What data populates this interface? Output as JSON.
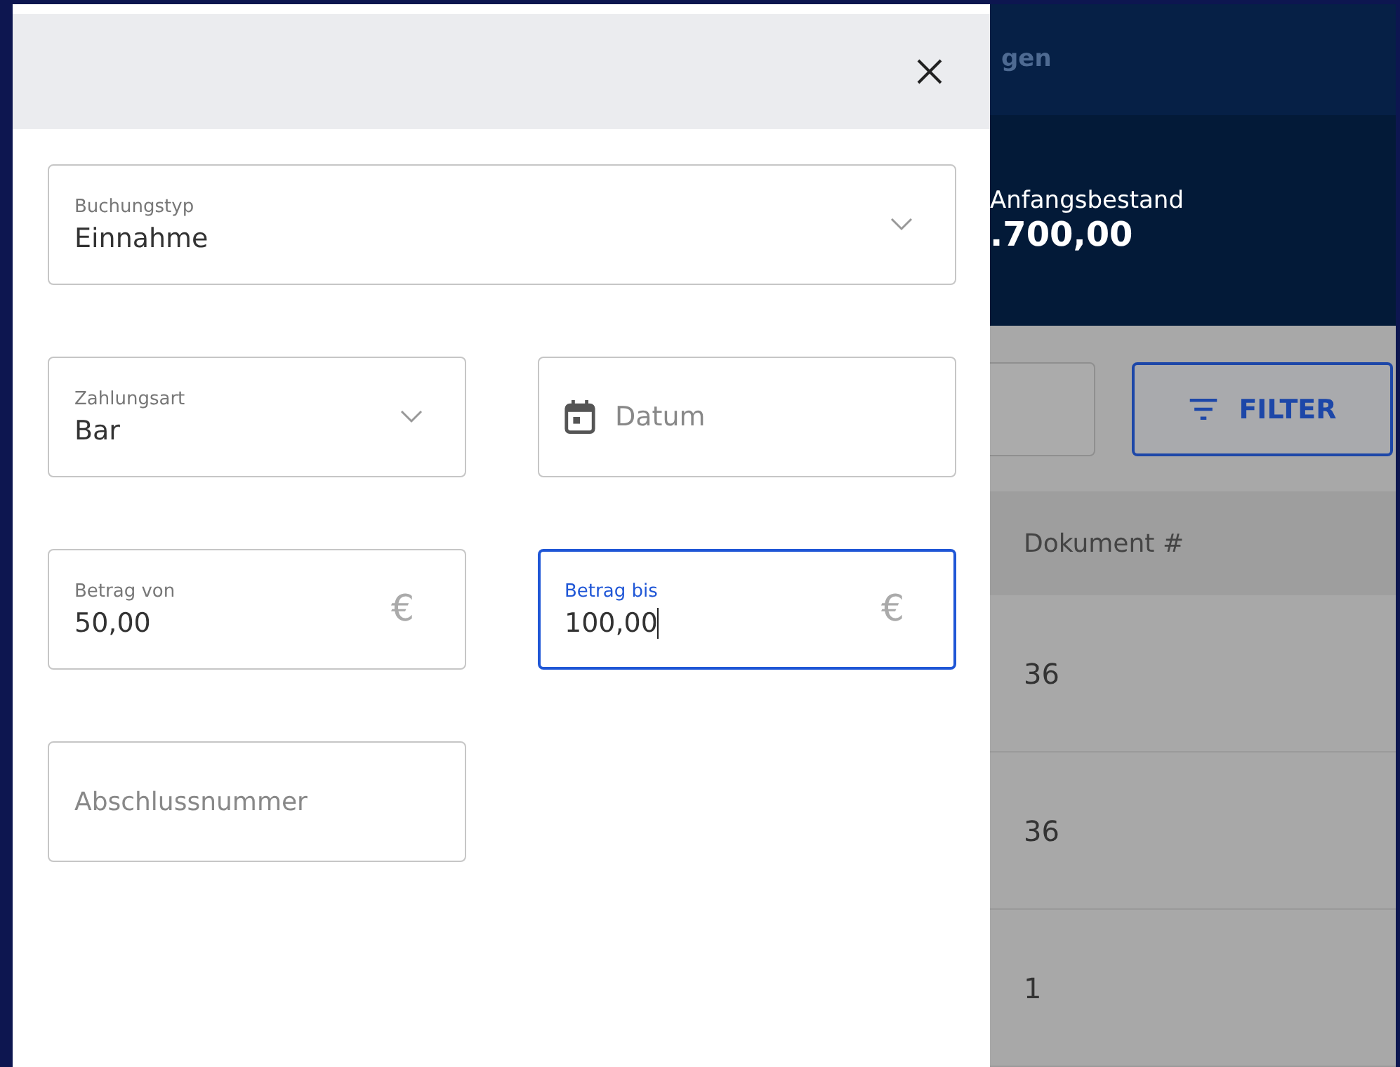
{
  "drawer": {
    "fields": [
      {
        "kind": "select",
        "label": "Buchungstyp",
        "value": "Einnahme",
        "focused": false
      },
      {
        "kind": "select",
        "label": "Zahlungsart",
        "value": "Bar",
        "focused": false
      },
      {
        "kind": "date",
        "placeholder": "Datum",
        "focused": false
      },
      {
        "kind": "amount",
        "label": "Betrag von",
        "value": "50,00",
        "suffix": "€",
        "focused": false
      },
      {
        "kind": "amount",
        "label": "Betrag bis",
        "value": "100,00",
        "suffix": "€",
        "focused": true
      },
      {
        "kind": "text",
        "placeholder": "Abschlussnummer",
        "focused": false
      }
    ]
  },
  "background_page": {
    "nav_text": "gen",
    "balance_label": "Anfangsbestand",
    "balance_value": ".700,00",
    "filter_button": "FILTER",
    "table": {
      "columns": [
        "Dokument #"
      ],
      "rows": [
        [
          "36"
        ],
        [
          "36"
        ],
        [
          "1"
        ]
      ]
    }
  }
}
